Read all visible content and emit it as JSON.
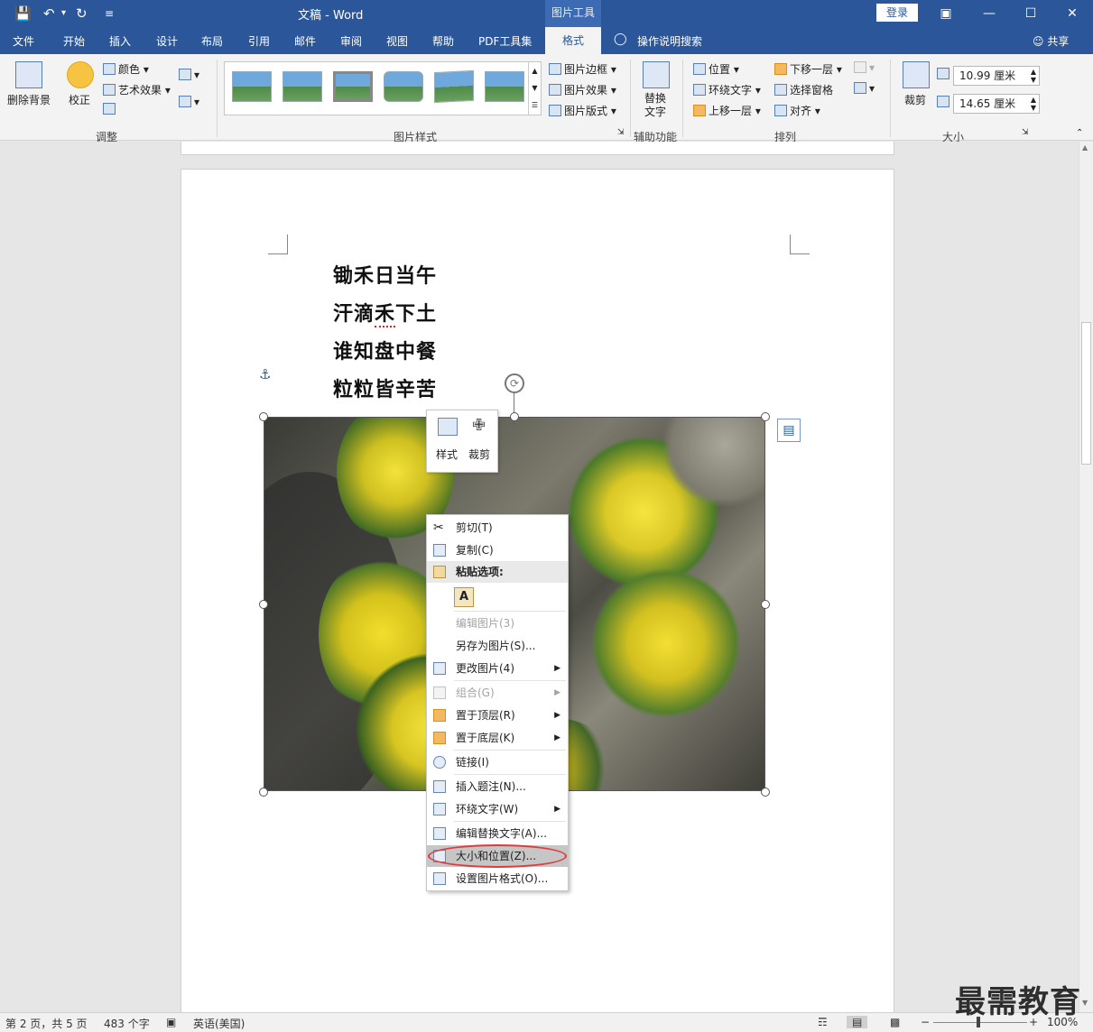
{
  "app": {
    "doc_title": "文稿",
    "app_name": "Word",
    "separator": " - ",
    "contextual_tools": "图片工具",
    "login": "登录"
  },
  "tabs": [
    "文件",
    "开始",
    "插入",
    "设计",
    "布局",
    "引用",
    "邮件",
    "审阅",
    "视图",
    "帮助",
    "PDF工具集"
  ],
  "active_tab": "格式",
  "tell_me": "操作说明搜索",
  "share": "共享",
  "ribbon": {
    "adjust": {
      "remove_bg": "删除背景",
      "correct": "校正",
      "color": "颜色",
      "artistic": "艺术效果",
      "group": "调整"
    },
    "styles": {
      "border": "图片边框",
      "effects": "图片效果",
      "layout": "图片版式",
      "group": "图片样式"
    },
    "access": {
      "alt_text_1": "替换",
      "alt_text_2": "文字",
      "group": "辅助功能"
    },
    "arrange": {
      "position": "位置",
      "wrap": "环绕文字",
      "bring_forward": "上移一层",
      "send_backward": "下移一层",
      "selection_pane": "选择窗格",
      "align": "对齐",
      "group": "排列"
    },
    "size": {
      "crop": "裁剪",
      "height": "10.99 厘米",
      "width": "14.65 厘米",
      "group": "大小"
    }
  },
  "poem": [
    "锄禾日当午",
    "汗滴",
    "禾",
    "下土",
    "谁知盘中餐",
    "粒粒皆辛苦"
  ],
  "mini_toolbar": {
    "style": "样式",
    "crop": "裁剪"
  },
  "context_menu": {
    "cut": "剪切(T)",
    "copy": "复制(C)",
    "paste_options": "粘贴选项:",
    "edit_picture": "编辑图片(3)",
    "save_as": "另存为图片(S)...",
    "change_picture": "更改图片(4)",
    "group": "组合(G)",
    "bring_to_front": "置于顶层(R)",
    "send_to_back": "置于底层(K)",
    "link": "链接(I)",
    "insert_caption": "插入题注(N)...",
    "wrap_text": "环绕文字(W)",
    "edit_alt_text": "编辑替换文字(A)...",
    "size_position": "大小和位置(Z)...",
    "format_picture": "设置图片格式(O)..."
  },
  "status": {
    "page": "第 2 页，共 5 页",
    "words": "483 个字",
    "language": "英语(美国)",
    "zoom": "100%"
  },
  "watermark": "最需教育",
  "colors": {
    "accent": "#2b579a",
    "highlight_oval": "#e03a3a"
  }
}
